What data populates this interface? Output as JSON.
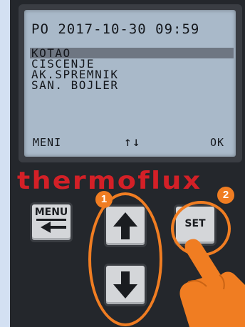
{
  "lcd": {
    "datetime": "PO 2017-10-30 09:59",
    "menu": [
      {
        "label": "KOTAO",
        "selected": true
      },
      {
        "label": "CISCENJE",
        "selected": false
      },
      {
        "label": "AK.SPREMNIK",
        "selected": false
      },
      {
        "label": "SAN. BOJLER",
        "selected": false
      }
    ],
    "softkeys": {
      "left": "MENI",
      "middle": "↑↓",
      "right": "OK"
    }
  },
  "brand": {
    "logo": "thermoflux",
    "color": "#d32027"
  },
  "buttons": {
    "menu_label": "MENU",
    "set_label": "SET",
    "up_icon": "arrow-up-icon",
    "down_icon": "arrow-down-icon"
  },
  "annotations": {
    "badge_1": "1",
    "badge_2": "2",
    "color": "#f07d22"
  }
}
